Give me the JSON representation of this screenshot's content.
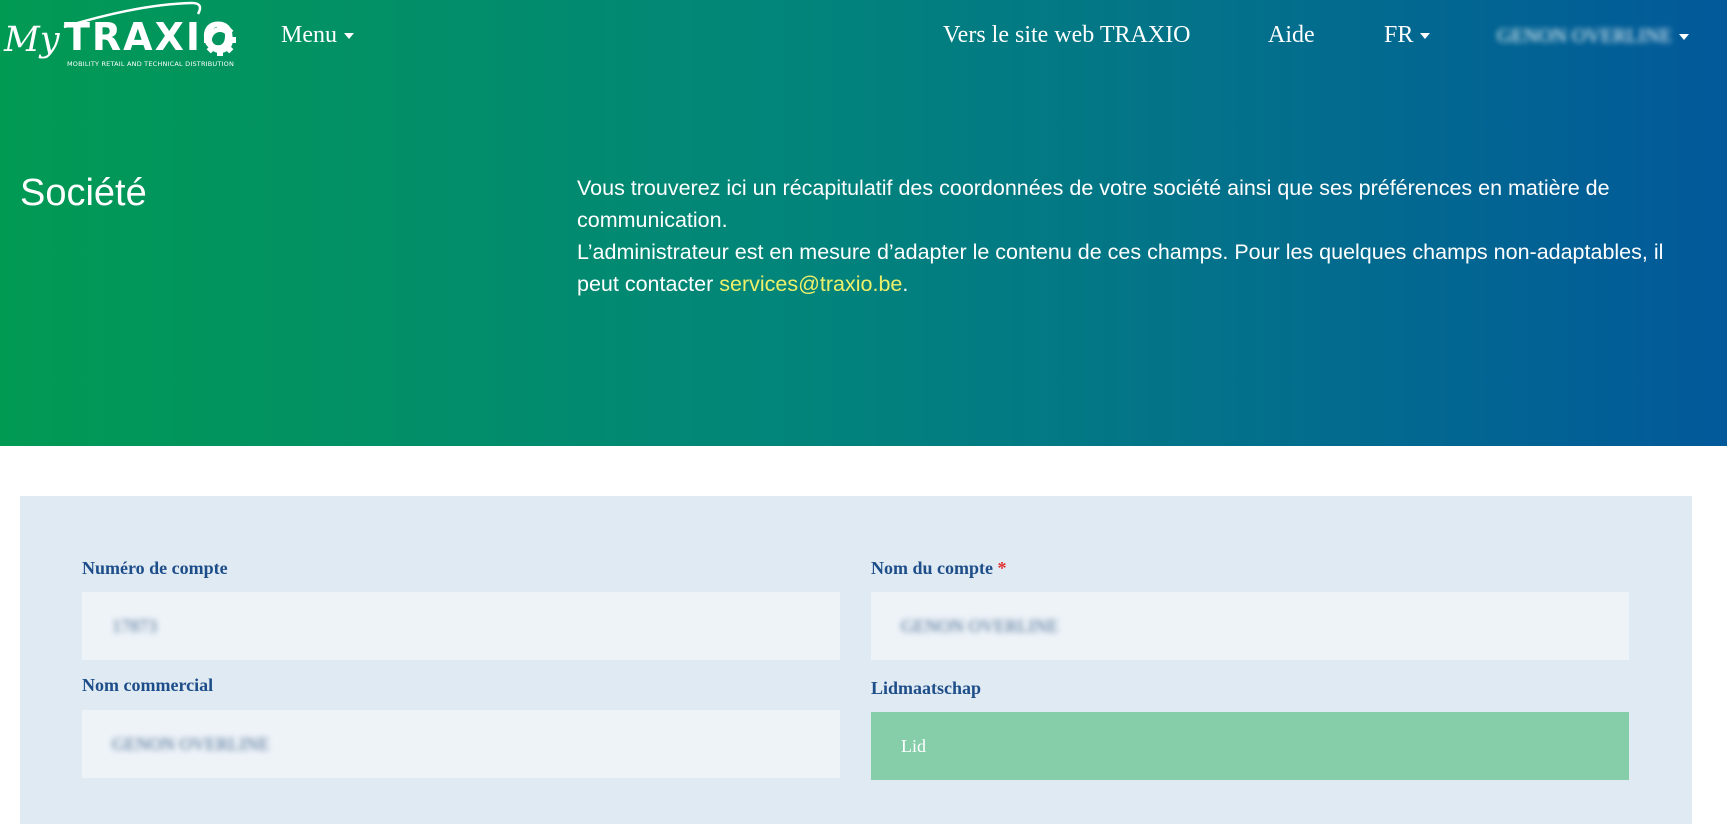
{
  "brand": {
    "my": "My",
    "name": "TRAXIO",
    "tagline": "MOBILITY RETAIL AND TECHNICAL DISTRIBUTION"
  },
  "nav": {
    "menu": "Menu",
    "website_link": "Vers le site web TRAXIO",
    "help": "Aide",
    "language": "FR",
    "user": "GENON OVERLINE"
  },
  "hero": {
    "title": "Société",
    "intro_line1": "Vous trouverez ici un récapitulatif des coordonnées de votre société ainsi que ses préférences en matière de communication.",
    "intro_line2_before": "L’administrateur est en mesure d’adapter le contenu de ces champs. Pour les quelques champs non-adaptables, il peut contacter ",
    "contact_email": "services@traxio.be",
    "intro_line2_after": "."
  },
  "form": {
    "account_number": {
      "label": "Numéro de compte",
      "value": "17873"
    },
    "account_name": {
      "label": "Nom du compte",
      "required_mark": "*",
      "value": "GENON OVERLINE"
    },
    "trade_name": {
      "label": "Nom commercial",
      "value": "GENON OVERLINE"
    },
    "membership": {
      "label": "Lidmaatschap",
      "value": "Lid"
    }
  },
  "colors": {
    "hero_start": "#019a53",
    "hero_end": "#02599a",
    "link": "#ecf06a",
    "label": "#1d4e8a",
    "membership_bg": "#86cda9",
    "panel_bg": "#e0eaf3"
  }
}
